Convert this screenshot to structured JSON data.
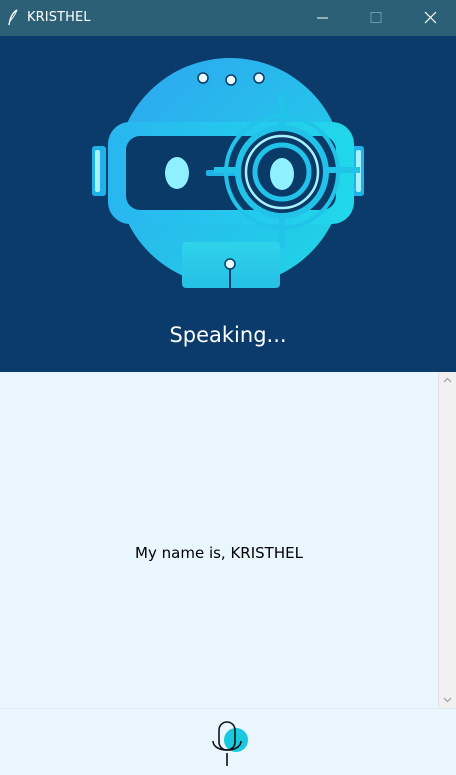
{
  "window": {
    "title": "KRISTHEL",
    "icons": {
      "app": "feather-icon",
      "minimize": "minimize-icon",
      "maximize": "maximize-icon",
      "close": "close-icon"
    }
  },
  "header": {
    "status": "Speaking...",
    "avatar": "robot-icon",
    "background": "#0b3b6a"
  },
  "chat": {
    "message": "My name is, KRISTHEL",
    "background": "#eaf6fd"
  },
  "controls": {
    "mic_icon": "microphone-icon",
    "mic_accent": "#19c9e0"
  },
  "colors": {
    "titlebar": "#2c6076",
    "robot_primary": "#21c4e8",
    "robot_dark": "#0a3a68"
  }
}
